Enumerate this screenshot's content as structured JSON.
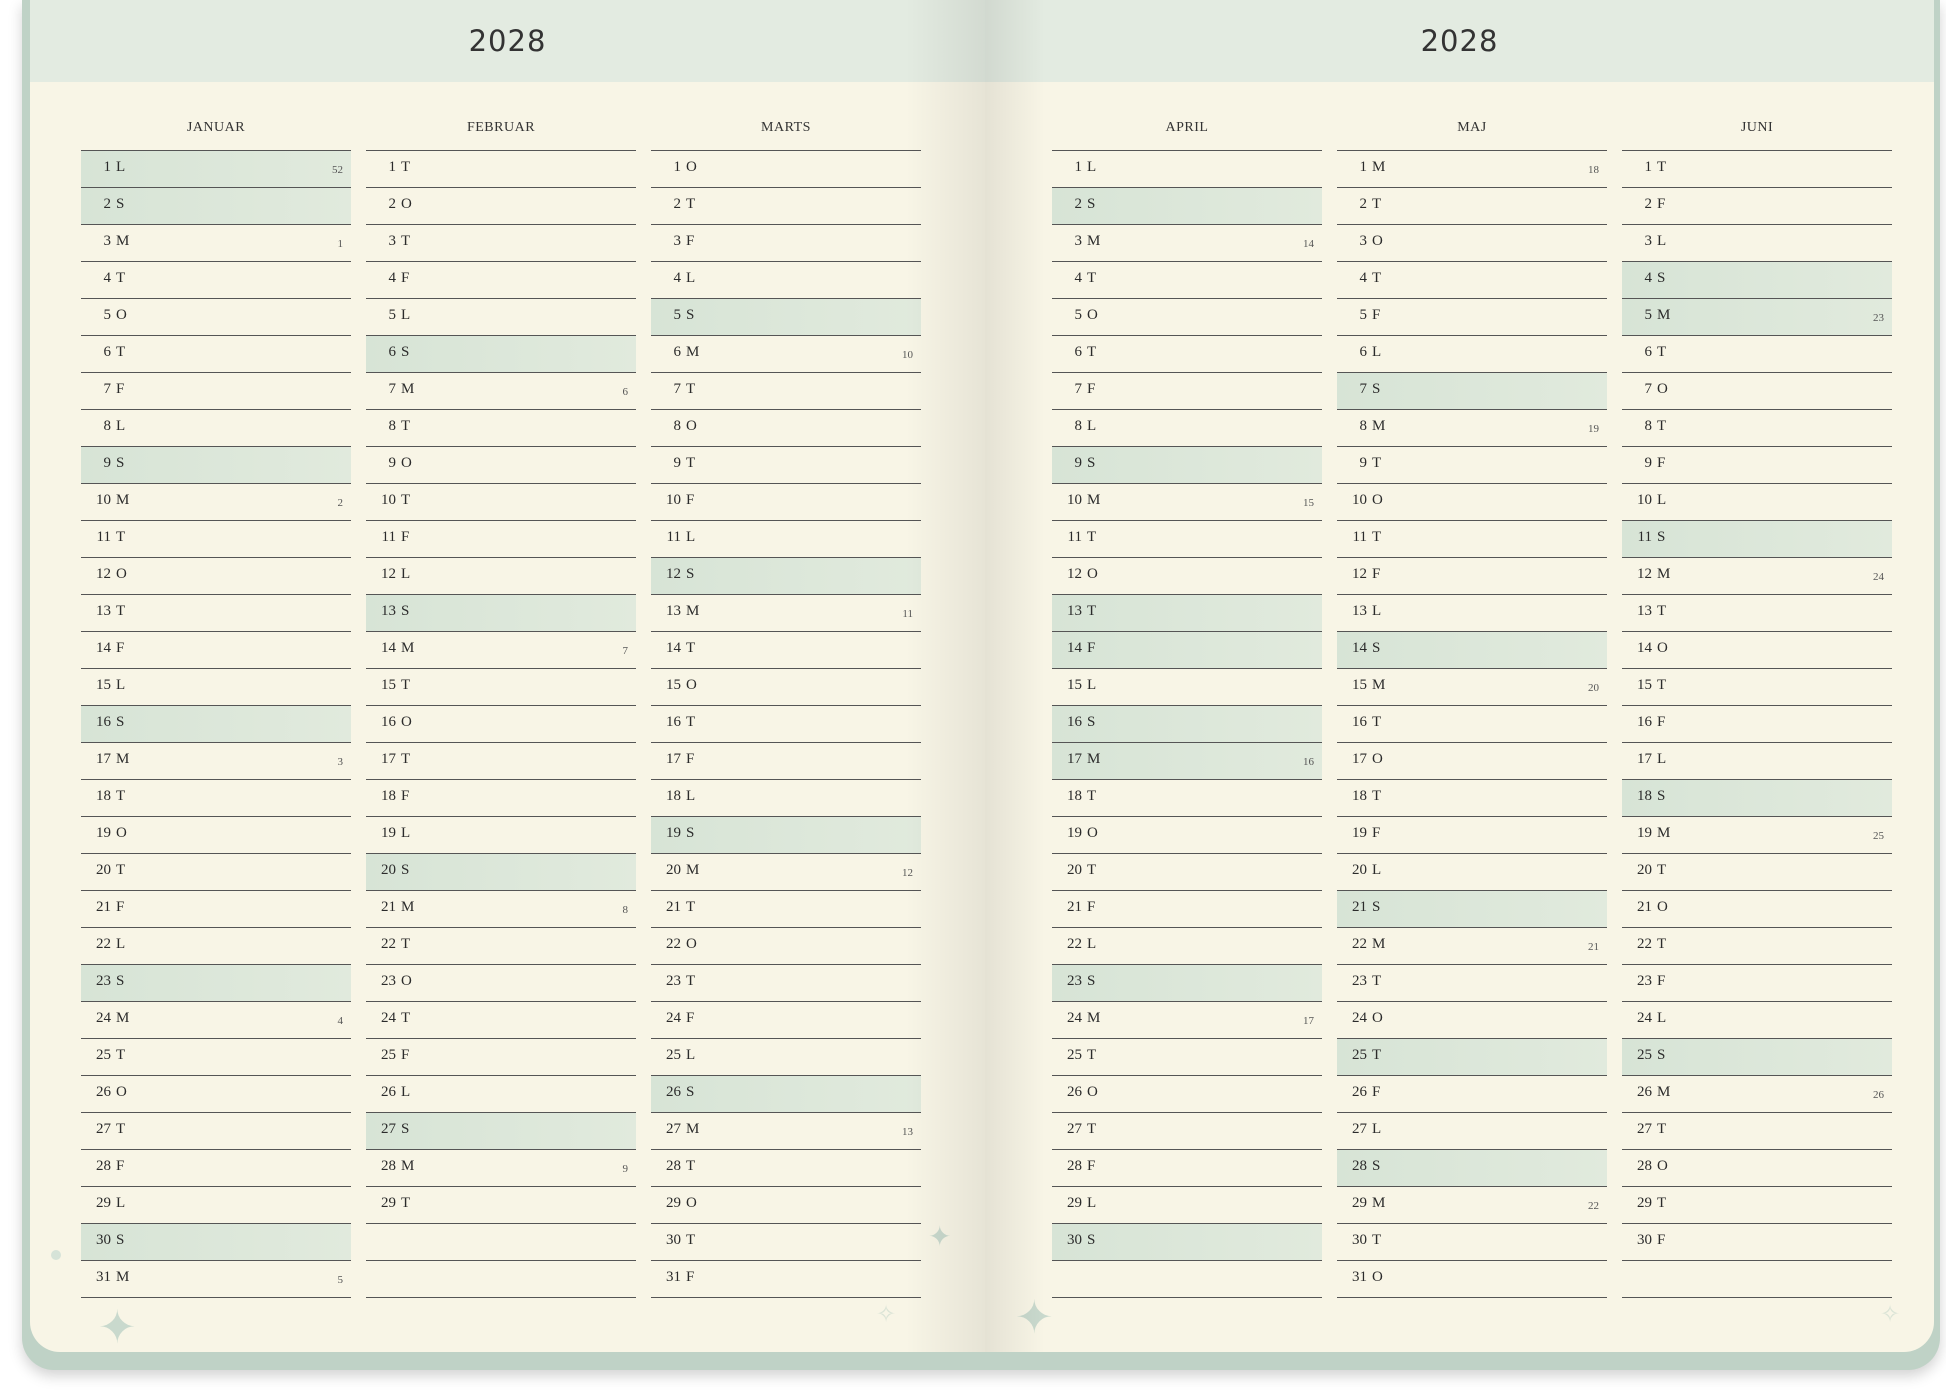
{
  "spreads": [
    {
      "year": "2028",
      "months": [
        {
          "name": "JANUAR",
          "days": [
            {
              "d": "1",
              "l": "L",
              "w": true,
              "wk": "52"
            },
            {
              "d": "2",
              "l": "S",
              "w": true
            },
            {
              "d": "3",
              "l": "M",
              "wk": "1"
            },
            {
              "d": "4",
              "l": "T"
            },
            {
              "d": "5",
              "l": "O"
            },
            {
              "d": "6",
              "l": "T"
            },
            {
              "d": "7",
              "l": "F"
            },
            {
              "d": "8",
              "l": "L"
            },
            {
              "d": "9",
              "l": "S",
              "w": true
            },
            {
              "d": "10",
              "l": "M",
              "wk": "2"
            },
            {
              "d": "11",
              "l": "T"
            },
            {
              "d": "12",
              "l": "O"
            },
            {
              "d": "13",
              "l": "T"
            },
            {
              "d": "14",
              "l": "F"
            },
            {
              "d": "15",
              "l": "L"
            },
            {
              "d": "16",
              "l": "S",
              "w": true
            },
            {
              "d": "17",
              "l": "M",
              "wk": "3"
            },
            {
              "d": "18",
              "l": "T"
            },
            {
              "d": "19",
              "l": "O"
            },
            {
              "d": "20",
              "l": "T"
            },
            {
              "d": "21",
              "l": "F"
            },
            {
              "d": "22",
              "l": "L"
            },
            {
              "d": "23",
              "l": "S",
              "w": true
            },
            {
              "d": "24",
              "l": "M",
              "wk": "4"
            },
            {
              "d": "25",
              "l": "T"
            },
            {
              "d": "26",
              "l": "O"
            },
            {
              "d": "27",
              "l": "T"
            },
            {
              "d": "28",
              "l": "F"
            },
            {
              "d": "29",
              "l": "L"
            },
            {
              "d": "30",
              "l": "S",
              "w": true
            },
            {
              "d": "31",
              "l": "M",
              "wk": "5"
            }
          ]
        },
        {
          "name": "FEBRUAR",
          "days": [
            {
              "d": "1",
              "l": "T"
            },
            {
              "d": "2",
              "l": "O"
            },
            {
              "d": "3",
              "l": "T"
            },
            {
              "d": "4",
              "l": "F"
            },
            {
              "d": "5",
              "l": "L"
            },
            {
              "d": "6",
              "l": "S",
              "w": true
            },
            {
              "d": "7",
              "l": "M",
              "wk": "6"
            },
            {
              "d": "8",
              "l": "T"
            },
            {
              "d": "9",
              "l": "O"
            },
            {
              "d": "10",
              "l": "T"
            },
            {
              "d": "11",
              "l": "F"
            },
            {
              "d": "12",
              "l": "L"
            },
            {
              "d": "13",
              "l": "S",
              "w": true
            },
            {
              "d": "14",
              "l": "M",
              "wk": "7"
            },
            {
              "d": "15",
              "l": "T"
            },
            {
              "d": "16",
              "l": "O"
            },
            {
              "d": "17",
              "l": "T"
            },
            {
              "d": "18",
              "l": "F"
            },
            {
              "d": "19",
              "l": "L"
            },
            {
              "d": "20",
              "l": "S",
              "w": true
            },
            {
              "d": "21",
              "l": "M",
              "wk": "8"
            },
            {
              "d": "22",
              "l": "T"
            },
            {
              "d": "23",
              "l": "O"
            },
            {
              "d": "24",
              "l": "T"
            },
            {
              "d": "25",
              "l": "F"
            },
            {
              "d": "26",
              "l": "L"
            },
            {
              "d": "27",
              "l": "S",
              "w": true
            },
            {
              "d": "28",
              "l": "M",
              "wk": "9"
            },
            {
              "d": "29",
              "l": "T"
            }
          ]
        },
        {
          "name": "MARTS",
          "days": [
            {
              "d": "1",
              "l": "O"
            },
            {
              "d": "2",
              "l": "T"
            },
            {
              "d": "3",
              "l": "F"
            },
            {
              "d": "4",
              "l": "L"
            },
            {
              "d": "5",
              "l": "S",
              "w": true
            },
            {
              "d": "6",
              "l": "M",
              "wk": "10"
            },
            {
              "d": "7",
              "l": "T"
            },
            {
              "d": "8",
              "l": "O"
            },
            {
              "d": "9",
              "l": "T"
            },
            {
              "d": "10",
              "l": "F"
            },
            {
              "d": "11",
              "l": "L"
            },
            {
              "d": "12",
              "l": "S",
              "w": true
            },
            {
              "d": "13",
              "l": "M",
              "wk": "11"
            },
            {
              "d": "14",
              "l": "T"
            },
            {
              "d": "15",
              "l": "O"
            },
            {
              "d": "16",
              "l": "T"
            },
            {
              "d": "17",
              "l": "F"
            },
            {
              "d": "18",
              "l": "L"
            },
            {
              "d": "19",
              "l": "S",
              "w": true
            },
            {
              "d": "20",
              "l": "M",
              "wk": "12"
            },
            {
              "d": "21",
              "l": "T"
            },
            {
              "d": "22",
              "l": "O"
            },
            {
              "d": "23",
              "l": "T"
            },
            {
              "d": "24",
              "l": "F"
            },
            {
              "d": "25",
              "l": "L"
            },
            {
              "d": "26",
              "l": "S",
              "w": true
            },
            {
              "d": "27",
              "l": "M",
              "wk": "13"
            },
            {
              "d": "28",
              "l": "T"
            },
            {
              "d": "29",
              "l": "O"
            },
            {
              "d": "30",
              "l": "T"
            },
            {
              "d": "31",
              "l": "F"
            }
          ]
        }
      ]
    },
    {
      "year": "2028",
      "months": [
        {
          "name": "APRIL",
          "days": [
            {
              "d": "1",
              "l": "L"
            },
            {
              "d": "2",
              "l": "S",
              "w": true
            },
            {
              "d": "3",
              "l": "M",
              "wk": "14"
            },
            {
              "d": "4",
              "l": "T"
            },
            {
              "d": "5",
              "l": "O"
            },
            {
              "d": "6",
              "l": "T"
            },
            {
              "d": "7",
              "l": "F"
            },
            {
              "d": "8",
              "l": "L"
            },
            {
              "d": "9",
              "l": "S",
              "w": true
            },
            {
              "d": "10",
              "l": "M",
              "wk": "15"
            },
            {
              "d": "11",
              "l": "T"
            },
            {
              "d": "12",
              "l": "O"
            },
            {
              "d": "13",
              "l": "T",
              "w": true
            },
            {
              "d": "14",
              "l": "F",
              "w": true
            },
            {
              "d": "15",
              "l": "L"
            },
            {
              "d": "16",
              "l": "S",
              "w": true
            },
            {
              "d": "17",
              "l": "M",
              "w": true,
              "wk": "16"
            },
            {
              "d": "18",
              "l": "T"
            },
            {
              "d": "19",
              "l": "O"
            },
            {
              "d": "20",
              "l": "T"
            },
            {
              "d": "21",
              "l": "F"
            },
            {
              "d": "22",
              "l": "L"
            },
            {
              "d": "23",
              "l": "S",
              "w": true
            },
            {
              "d": "24",
              "l": "M",
              "wk": "17"
            },
            {
              "d": "25",
              "l": "T"
            },
            {
              "d": "26",
              "l": "O"
            },
            {
              "d": "27",
              "l": "T"
            },
            {
              "d": "28",
              "l": "F"
            },
            {
              "d": "29",
              "l": "L"
            },
            {
              "d": "30",
              "l": "S",
              "w": true
            }
          ]
        },
        {
          "name": "MAJ",
          "days": [
            {
              "d": "1",
              "l": "M",
              "wk": "18"
            },
            {
              "d": "2",
              "l": "T"
            },
            {
              "d": "3",
              "l": "O"
            },
            {
              "d": "4",
              "l": "T"
            },
            {
              "d": "5",
              "l": "F"
            },
            {
              "d": "6",
              "l": "L"
            },
            {
              "d": "7",
              "l": "S",
              "w": true
            },
            {
              "d": "8",
              "l": "M",
              "wk": "19"
            },
            {
              "d": "9",
              "l": "T"
            },
            {
              "d": "10",
              "l": "O"
            },
            {
              "d": "11",
              "l": "T"
            },
            {
              "d": "12",
              "l": "F"
            },
            {
              "d": "13",
              "l": "L"
            },
            {
              "d": "14",
              "l": "S",
              "w": true
            },
            {
              "d": "15",
              "l": "M",
              "wk": "20"
            },
            {
              "d": "16",
              "l": "T"
            },
            {
              "d": "17",
              "l": "O"
            },
            {
              "d": "18",
              "l": "T"
            },
            {
              "d": "19",
              "l": "F"
            },
            {
              "d": "20",
              "l": "L"
            },
            {
              "d": "21",
              "l": "S",
              "w": true
            },
            {
              "d": "22",
              "l": "M",
              "wk": "21"
            },
            {
              "d": "23",
              "l": "T"
            },
            {
              "d": "24",
              "l": "O"
            },
            {
              "d": "25",
              "l": "T",
              "w": true
            },
            {
              "d": "26",
              "l": "F"
            },
            {
              "d": "27",
              "l": "L"
            },
            {
              "d": "28",
              "l": "S",
              "w": true
            },
            {
              "d": "29",
              "l": "M",
              "wk": "22"
            },
            {
              "d": "30",
              "l": "T"
            },
            {
              "d": "31",
              "l": "O"
            }
          ]
        },
        {
          "name": "JUNI",
          "days": [
            {
              "d": "1",
              "l": "T"
            },
            {
              "d": "2",
              "l": "F"
            },
            {
              "d": "3",
              "l": "L"
            },
            {
              "d": "4",
              "l": "S",
              "w": true
            },
            {
              "d": "5",
              "l": "M",
              "w": true,
              "wk": "23"
            },
            {
              "d": "6",
              "l": "T"
            },
            {
              "d": "7",
              "l": "O"
            },
            {
              "d": "8",
              "l": "T"
            },
            {
              "d": "9",
              "l": "F"
            },
            {
              "d": "10",
              "l": "L"
            },
            {
              "d": "11",
              "l": "S",
              "w": true
            },
            {
              "d": "12",
              "l": "M",
              "wk": "24"
            },
            {
              "d": "13",
              "l": "T"
            },
            {
              "d": "14",
              "l": "O"
            },
            {
              "d": "15",
              "l": "T"
            },
            {
              "d": "16",
              "l": "F"
            },
            {
              "d": "17",
              "l": "L"
            },
            {
              "d": "18",
              "l": "S",
              "w": true
            },
            {
              "d": "19",
              "l": "M",
              "wk": "25"
            },
            {
              "d": "20",
              "l": "T"
            },
            {
              "d": "21",
              "l": "O"
            },
            {
              "d": "22",
              "l": "T"
            },
            {
              "d": "23",
              "l": "F"
            },
            {
              "d": "24",
              "l": "L"
            },
            {
              "d": "25",
              "l": "S",
              "w": true
            },
            {
              "d": "26",
              "l": "M",
              "wk": "26"
            },
            {
              "d": "27",
              "l": "T"
            },
            {
              "d": "28",
              "l": "O"
            },
            {
              "d": "29",
              "l": "T"
            },
            {
              "d": "30",
              "l": "F"
            }
          ]
        }
      ]
    }
  ],
  "decorations": {
    "icon": "sparkle-icon",
    "accent_color": "#d7e4d6",
    "cover_color": "#bfd2c6"
  }
}
